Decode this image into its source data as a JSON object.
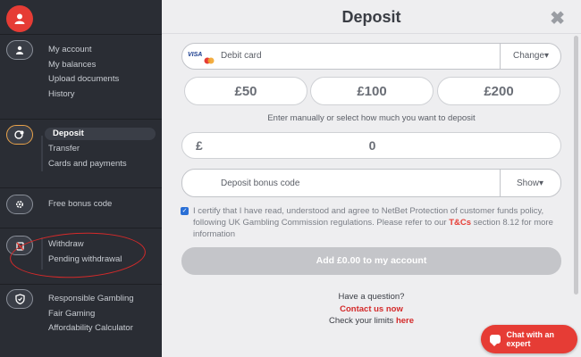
{
  "sidebar": {
    "groups": [
      {
        "icon": "user-icon",
        "items": [
          "My account",
          "My balances",
          "Upload documents",
          "History"
        ]
      },
      {
        "icon": "wallet-icon",
        "items": [
          "Deposit",
          "Transfer",
          "Cards and payments"
        ],
        "active_item": "Deposit"
      },
      {
        "icon": "gift-icon",
        "items": [
          "Free bonus code"
        ]
      },
      {
        "icon": "withdraw-icon",
        "items": [
          "Withdraw",
          "Pending withdrawal"
        ]
      },
      {
        "icon": "shield-icon",
        "items": [
          "Responsible Gambling",
          "Fair Gaming",
          "Affordability Calculator"
        ]
      }
    ]
  },
  "modal": {
    "title": "Deposit",
    "close_label": "✖",
    "payment_method": {
      "brands": "VISA",
      "label": "Debit card",
      "change_label": "Change▾"
    },
    "amounts": [
      "£50",
      "£100",
      "£200"
    ],
    "hint": "Enter manually or select how much you want to deposit",
    "amount_field": {
      "currency": "£",
      "value": "0"
    },
    "bonus_code": {
      "placeholder": "Deposit bonus code",
      "show_label": "Show▾"
    },
    "terms": {
      "text_before": "I certify that I have read, understood and agree to NetBet Protection of customer funds policy, following UK Gambling Commission regulations. Please refer to our ",
      "link": "T&Cs",
      "text_after": " section 8.12 for more information"
    },
    "submit_label": "Add £0.00 to my account",
    "help": {
      "question": "Have a question?",
      "contact_link": "Contact us now",
      "limits_text": "Check your limits ",
      "limits_link": "here"
    }
  },
  "chat": {
    "label": "Chat with an expert"
  },
  "colors": {
    "accent": "#e63c35",
    "sidebar_bg": "#2a2d34",
    "modal_bg": "#eeeef0"
  }
}
